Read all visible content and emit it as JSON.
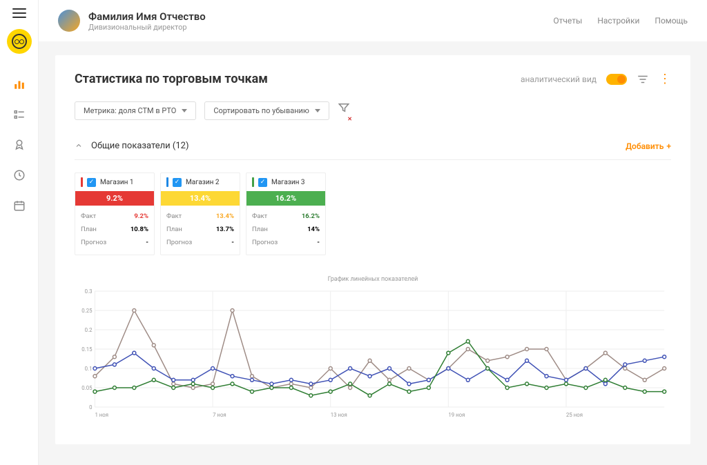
{
  "user": {
    "name": "Фамилия Имя Отчество",
    "role": "Дивизиональный директор"
  },
  "topnav": {
    "reports": "Отчеты",
    "settings": "Настройки",
    "help": "Помощь"
  },
  "page": {
    "title": "Статистика по торговым точкам",
    "analytical_label": "аналитический вид"
  },
  "filters": {
    "metric": "Метрика: доля СТМ в РТО",
    "sort": "Сортировать по убыванию"
  },
  "section": {
    "title": "Общие показатели (12)",
    "add": "Добавить"
  },
  "stores": [
    {
      "name": "Магазин 1",
      "marker": "#E53935",
      "band_bg": "#E53935",
      "big": "9.2%",
      "fact": "9.2%",
      "fact_color": "#E53935",
      "plan": "10.8%",
      "forecast": "-"
    },
    {
      "name": "Магазин 2",
      "marker": "#1E88E5",
      "band_bg": "#FDD835",
      "big": "13.4%",
      "fact": "13.4%",
      "fact_color": "#F9A825",
      "plan": "13.7%",
      "forecast": "-"
    },
    {
      "name": "Магазин 3",
      "marker": "#43A047",
      "band_bg": "#4CAF50",
      "big": "16.2%",
      "fact": "16.2%",
      "fact_color": "#2E7D32",
      "plan": "14%",
      "forecast": "-"
    }
  ],
  "row_labels": {
    "fact": "Факт",
    "plan": "План",
    "forecast": "Прогноз"
  },
  "chart": {
    "title": "График линейных показателей"
  },
  "chart_data": {
    "type": "line",
    "ylabel": "",
    "xlabel": "",
    "ylim": [
      0,
      0.3
    ],
    "y_ticks": [
      0,
      0.05,
      0.1,
      0.15,
      0.2,
      0.25,
      0.3
    ],
    "x_ticks": [
      "1 ноя",
      "7 ноя",
      "13 ноя",
      "19 ноя",
      "25 ноя"
    ],
    "categories": [
      1,
      2,
      3,
      4,
      5,
      6,
      7,
      8,
      9,
      10,
      11,
      12,
      13,
      14,
      15,
      16,
      17,
      18,
      19,
      20,
      21,
      22,
      23,
      24,
      25,
      26,
      27,
      28,
      29,
      30
    ],
    "series": [
      {
        "name": "Магазин 1",
        "color": "#9E8B85",
        "values": [
          0.08,
          0.13,
          0.25,
          0.16,
          0.06,
          0.05,
          0.06,
          0.25,
          0.08,
          0.05,
          0.06,
          0.05,
          0.1,
          0.05,
          0.12,
          0.07,
          0.1,
          0.07,
          0.1,
          0.15,
          0.12,
          0.13,
          0.15,
          0.15,
          0.07,
          0.1,
          0.14,
          0.1,
          0.07,
          0.1
        ]
      },
      {
        "name": "Магазин 2",
        "color": "#3F51B5",
        "values": [
          0.1,
          0.11,
          0.14,
          0.1,
          0.07,
          0.07,
          0.1,
          0.08,
          0.07,
          0.06,
          0.07,
          0.06,
          0.07,
          0.1,
          0.08,
          0.1,
          0.06,
          0.07,
          0.1,
          0.07,
          0.1,
          0.07,
          0.12,
          0.08,
          0.07,
          0.1,
          0.06,
          0.11,
          0.12,
          0.13
        ]
      },
      {
        "name": "Магазин 3",
        "color": "#2E7D32",
        "values": [
          0.04,
          0.05,
          0.05,
          0.07,
          0.05,
          0.06,
          0.05,
          0.06,
          0.04,
          0.05,
          0.05,
          0.03,
          0.04,
          0.06,
          0.03,
          0.06,
          0.04,
          0.05,
          0.14,
          0.17,
          0.1,
          0.05,
          0.06,
          0.05,
          0.06,
          0.05,
          0.07,
          0.05,
          0.04,
          0.04
        ]
      }
    ]
  }
}
